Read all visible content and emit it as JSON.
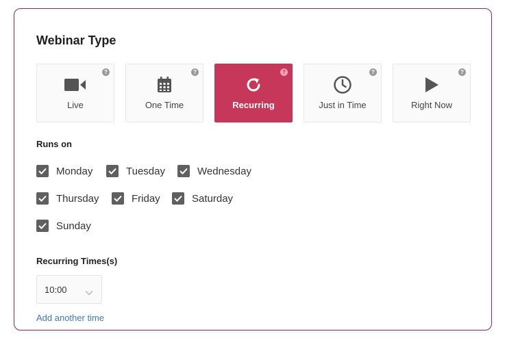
{
  "webinar": {
    "title": "Webinar Type",
    "types": [
      {
        "label": "Live",
        "icon": "video-camera-icon",
        "help": "?",
        "active": false
      },
      {
        "label": "One Time",
        "icon": "calendar-icon",
        "help": "?",
        "active": false
      },
      {
        "label": "Recurring",
        "icon": "refresh-icon",
        "help": "?",
        "active": true
      },
      {
        "label": "Just in Time",
        "icon": "clock-icon",
        "help": "?",
        "active": false
      },
      {
        "label": "Right Now",
        "icon": "play-icon",
        "help": "?",
        "active": false
      }
    ],
    "accent_color": "#c7375a"
  },
  "runs_on": {
    "label": "Runs on",
    "days": [
      {
        "label": "Monday",
        "checked": true
      },
      {
        "label": "Tuesday",
        "checked": true
      },
      {
        "label": "Wednesday",
        "checked": true
      },
      {
        "label": "Thursday",
        "checked": true
      },
      {
        "label": "Friday",
        "checked": true
      },
      {
        "label": "Saturday",
        "checked": true
      },
      {
        "label": "Sunday",
        "checked": true
      }
    ]
  },
  "recurring_times": {
    "label": "Recurring Times(s)",
    "time_value": "10:00",
    "add_link": "Add another time"
  }
}
